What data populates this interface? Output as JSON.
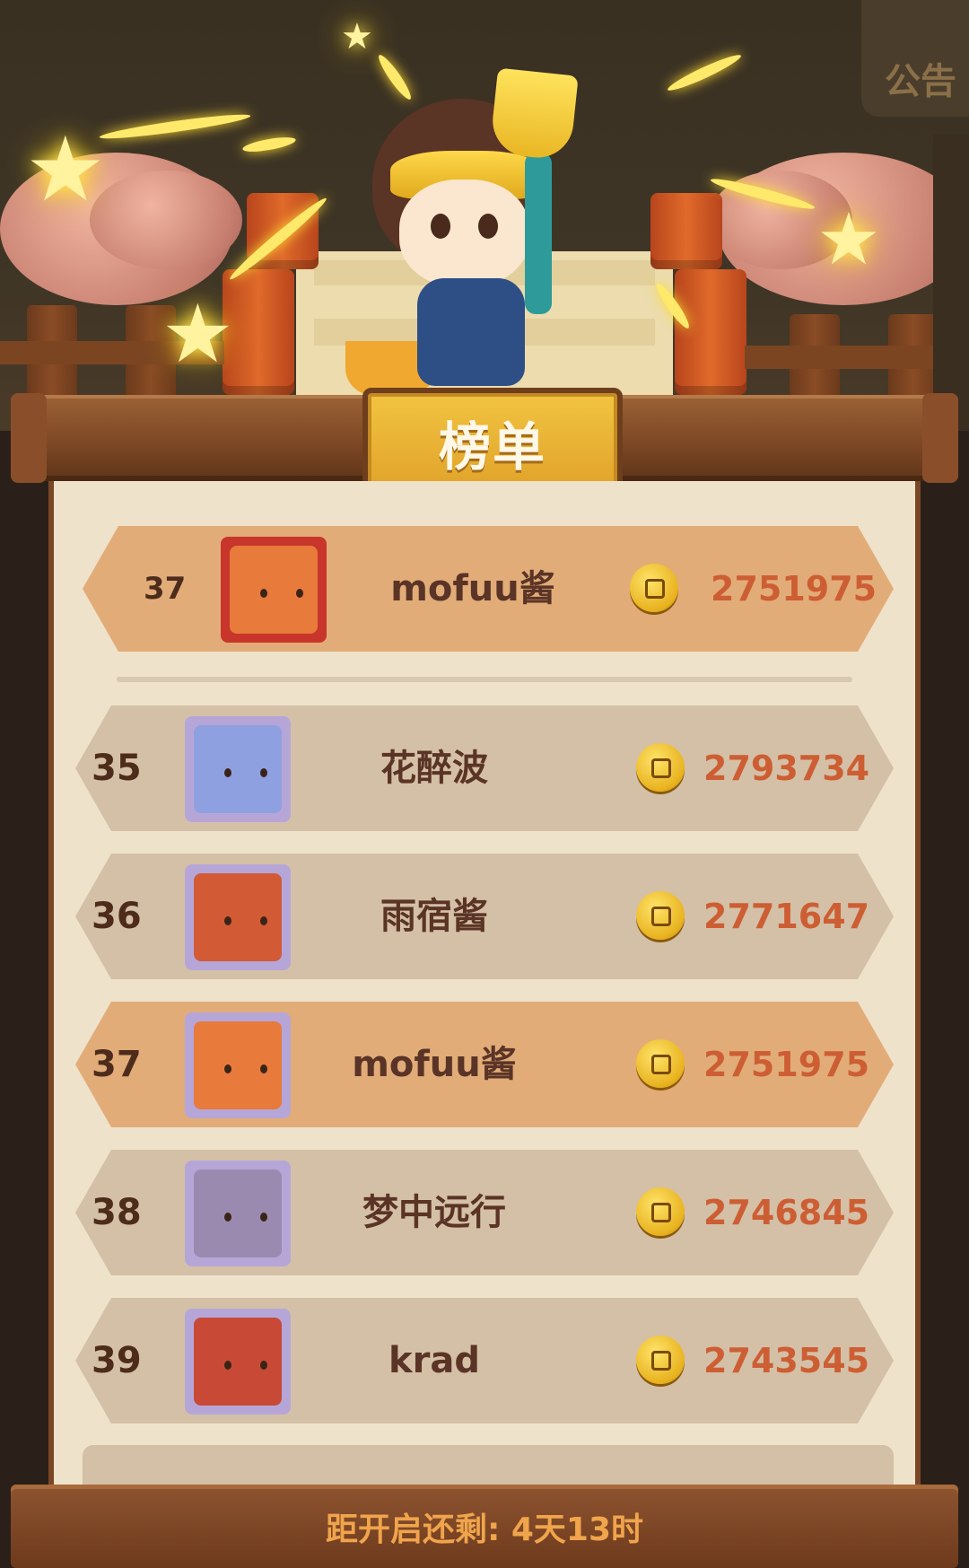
{
  "banner": {
    "title": "榜单"
  },
  "corner": {
    "notice_label": "公告"
  },
  "my_entry": {
    "rank": "37",
    "name": "mofuu酱",
    "score": "2751975",
    "avatar_color": "#e87a3c"
  },
  "leaderboard": [
    {
      "rank": "35",
      "name": "花醉波",
      "score": "2793734",
      "avatar_color": "#8fa0e0",
      "highlight": false
    },
    {
      "rank": "36",
      "name": "雨宿酱",
      "score": "2771647",
      "avatar_color": "#d25a34",
      "highlight": false
    },
    {
      "rank": "37",
      "name": "mofuu酱",
      "score": "2751975",
      "avatar_color": "#e87a3c",
      "highlight": true
    },
    {
      "rank": "38",
      "name": "梦中远行",
      "score": "2746845",
      "avatar_color": "#9a8ab0",
      "highlight": false
    },
    {
      "rank": "39",
      "name": "krad",
      "score": "2743545",
      "avatar_color": "#c84a36",
      "highlight": false
    }
  ],
  "footer": {
    "countdown": "距开启还剩: 4天13时"
  },
  "colors": {
    "score": "#cd5e34",
    "highlight_row": "#e2ac78",
    "normal_row": "#d4c0a6",
    "panel": "#efe2cb",
    "title_plate": "#f2c441"
  },
  "icons": {
    "currency": "coin-icon"
  }
}
